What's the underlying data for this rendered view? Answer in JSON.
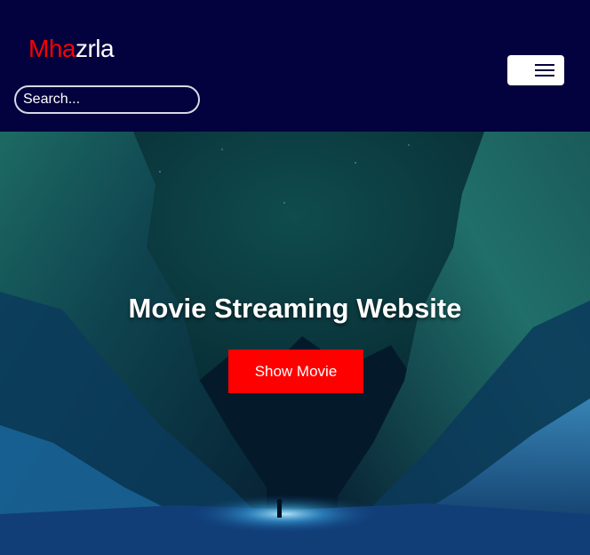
{
  "navbar": {
    "brand_accent": "Mha",
    "brand_rest": "zrla",
    "search_placeholder": "Search...",
    "menu_icon": "hamburger-icon",
    "colors": {
      "background": "#03023e",
      "brand_accent": "#ff0000",
      "brand_text": "#ffffff"
    }
  },
  "hero": {
    "title": "Movie Streaming Website",
    "button_label": "Show Movie",
    "colors": {
      "button": "#ff0000",
      "title": "#ffffff"
    }
  }
}
